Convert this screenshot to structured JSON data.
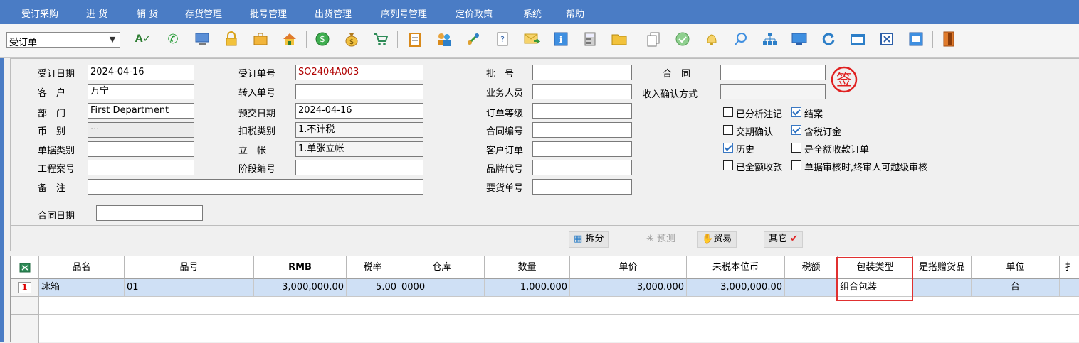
{
  "menu": [
    "受订采购",
    "进 货",
    "销 货",
    "存货管理",
    "批号管理",
    "出货管理",
    "序列号管理",
    "定价政策",
    "系统",
    "帮助"
  ],
  "toolbar": {
    "doc_type": "受订单",
    "icons": [
      "spellcheck-icon",
      "phone-icon",
      "monitor-icon",
      "lock-icon",
      "briefcase-icon",
      "home-icon",
      "dollar-icon",
      "money-bag-icon",
      "cart-icon",
      "clipboard-icon",
      "users-icon",
      "link-icon",
      "help-doc-icon",
      "mail-icon",
      "info-icon",
      "calculator-icon",
      "folder-icon",
      "copy-doc-icon",
      "check-circle-icon",
      "bell-icon",
      "search-icon",
      "org-chart-icon",
      "display-icon",
      "refresh-icon",
      "window-icon",
      "close-box-icon",
      "restore-icon",
      "exit-door-icon"
    ]
  },
  "form": {
    "order_date_label": "受订日期",
    "order_date": "2024-04-16",
    "customer_label": "客　户",
    "customer": "万宁",
    "department_label": "部　门",
    "department": "First Department",
    "currency_label": "币　别",
    "currency": "···",
    "doc_category_label": "单据类别",
    "doc_category": "",
    "project_no_label": "工程案号",
    "project_no": "",
    "remark_label": "备　注",
    "remark": "",
    "contract_date_label": "合同日期",
    "contract_date": "",
    "order_no_label": "受订单号",
    "order_no": "SO2404A003",
    "transfer_no_label": "转入单号",
    "transfer_no": "",
    "delivery_date_label": "预交日期",
    "delivery_date": "2024-04-16",
    "tax_type_label": "扣税类别",
    "tax_type": "1.不计税",
    "account_label": "立　帐",
    "account": "1.单张立帐",
    "stage_no_label": "阶段编号",
    "stage_no": "",
    "batch_no_label": "批　号",
    "batch_no": "",
    "salesperson_label": "业务人员",
    "salesperson": "",
    "order_level_label": "订单等级",
    "order_level": "",
    "contract_no_label": "合同编号",
    "contract_no": "",
    "customer_order_label": "客户订单",
    "customer_order": "",
    "brand_code_label": "品牌代号",
    "brand_code": "",
    "demand_no_label": "要货单号",
    "demand_no": "",
    "contract_label": "合　同",
    "contract": "",
    "revenue_method_label": "收入确认方式",
    "revenue_method": "",
    "stamp_char": "签"
  },
  "checkboxes": [
    {
      "label": "已分析注记",
      "checked": false
    },
    {
      "label": "结案",
      "checked": true
    },
    {
      "label": "交期确认",
      "checked": false
    },
    {
      "label": "含税订金",
      "checked": true
    },
    {
      "label": "历史",
      "checked": true
    },
    {
      "label": "是全额收款订单",
      "checked": false
    },
    {
      "label": "已全额收款",
      "checked": false
    },
    {
      "label": "单据审核时,终审人可越级审核",
      "checked": false
    }
  ],
  "actions": {
    "split": "拆分",
    "forecast": "预测",
    "trade": "贸易",
    "other": "其它"
  },
  "grid": {
    "columns": [
      "品名",
      "品号",
      "RMB",
      "税率",
      "仓库",
      "数量",
      "单价",
      "未税本位币",
      "税额",
      "包装类型",
      "是搭赠货品",
      "单位",
      "扌"
    ],
    "rows": [
      {
        "num": "1",
        "name": "冰箱",
        "code": "01",
        "rmb": "3,000,000.00",
        "tax_rate": "5.00",
        "warehouse": "0000",
        "qty": "1,000.000",
        "price": "3,000.000",
        "untaxed": "3,000,000.00",
        "tax": "",
        "pack_type": "组合包装",
        "is_gift": "",
        "unit": "台"
      }
    ]
  },
  "colors": {
    "menu_bg": "#4a7cc5",
    "highlight_border": "#e03030",
    "selected_row": "#cfe0f5"
  }
}
